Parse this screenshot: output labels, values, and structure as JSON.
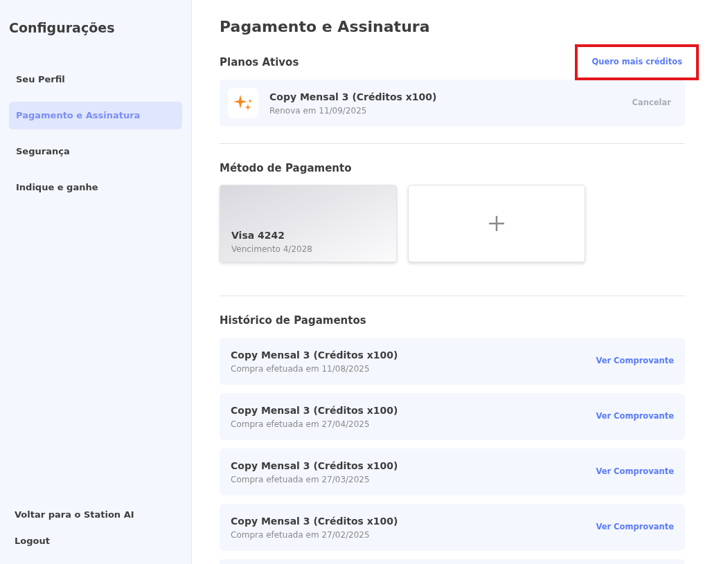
{
  "sidebar": {
    "title": "Configurações",
    "items": [
      {
        "label": "Seu Perfil",
        "selected": false
      },
      {
        "label": "Pagamento e Assinatura",
        "selected": true
      },
      {
        "label": "Segurança",
        "selected": false
      },
      {
        "label": "Indique e ganhe",
        "selected": false
      }
    ],
    "footer_links": [
      "Voltar para o Station AI",
      "Logout"
    ]
  },
  "page_title": "Pagamento e Assinatura",
  "active_plans": {
    "heading": "Planos Ativos",
    "action": "Quero mais créditos",
    "action_highlighted": true,
    "plans": [
      {
        "name": "Copy Mensal 3 (Créditos x100)",
        "renewal": "Renova em 11/09/2025",
        "cancel": "Cancelar",
        "cancel_disabled": true
      }
    ]
  },
  "payment_method": {
    "heading": "Método de Pagamento",
    "cards": [
      {
        "name": "Visa 4242",
        "expiry": "Vencimento 4/2028"
      }
    ]
  },
  "history": {
    "heading": "Histórico de Pagamentos",
    "rows": [
      {
        "name": "Copy Mensal 3 (Créditos x100)",
        "date": "Compra efetuada em 11/08/2025",
        "action": "Ver Comprovante"
      },
      {
        "name": "Copy Mensal 3 (Créditos x100)",
        "date": "Compra efetuada em 27/04/2025",
        "action": "Ver Comprovante"
      },
      {
        "name": "Copy Mensal 3 (Créditos x100)",
        "date": "Compra efetuada em 27/03/2025",
        "action": "Ver Comprovante"
      },
      {
        "name": "Copy Mensal 3 (Créditos x100)",
        "date": "Compra efetuada em 27/02/2025",
        "action": "Ver Comprovante"
      }
    ],
    "more_rows_below": true
  }
}
